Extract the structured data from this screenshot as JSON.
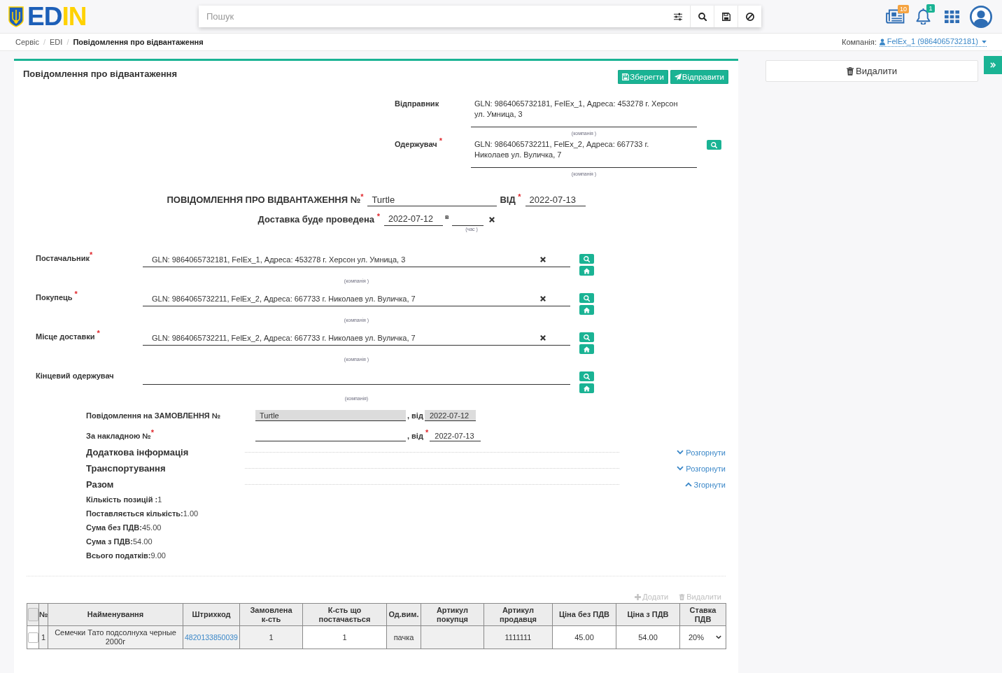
{
  "header": {
    "logo": [
      {
        "text": "ED",
        "color": "#1d5fb8"
      },
      {
        "text": "IN",
        "color": "#ffd200"
      }
    ],
    "search": {
      "placeholder": "Пошук"
    },
    "notifications": [
      {
        "kind": "news",
        "badge": "10",
        "color": "#f5a340"
      },
      {
        "kind": "bell",
        "badge": "1",
        "color": "#1ab394"
      }
    ]
  },
  "breadcrumb": [
    {
      "label": "Сервіс",
      "separator": "/",
      "current": false
    },
    {
      "label": "EDI",
      "separator": "/",
      "current": false
    },
    {
      "label": "Повідомлення про відвантаження",
      "current": true
    }
  ],
  "company": {
    "label": "Компанія:",
    "value": "FelEx_1 (9864065732181)"
  },
  "document": {
    "title": "Повідомлення про відвантаження",
    "actions": [
      {
        "kind": "save",
        "label": "Зберегти"
      },
      {
        "kind": "send",
        "label": "Відправити"
      }
    ],
    "correspondents": [
      {
        "label": "Відправник",
        "value": "GLN: 9864065732181, FelEx_1, Адреса: 453278 г. Херсон ул. Умница, 3",
        "caption": "(компанія )",
        "searchable": false
      },
      {
        "label": "Одержувач $^{*}$",
        "value": "GLN: 9864065732211, FelEx_2, Адреса: 667733 г. Николаев ул. Вуличка, 7",
        "caption": "(компанія )",
        "searchable": true
      }
    ],
    "number": {
      "label": "ПОВІДОМЛЕННЯ ПРО ВІДВАНТАЖЕННЯ №$^{*}$",
      "value": "Turtle",
      "date_label": "ВІД $^{*}$",
      "date": "2022-07-13"
    },
    "delivery": {
      "label": "Доставка буде проведена $^{*}$",
      "date": "2022-07-12",
      "time_label": "в",
      "time_caption": "(час )"
    },
    "parties": [
      {
        "label": "Постачальник$^{*}$",
        "value": "GLN: 9864065732181, FelEx_1, Адреса: 453278 г. Херсон ул. Умница, 3",
        "caption": "(компанія )"
      },
      {
        "label": "Покупець $^{*}$",
        "value": "GLN: 9864065732211, FelEx_2, Адреса: 667733 г. Николаев ул. Вуличка, 7",
        "caption": "(компанія )"
      },
      {
        "label": "Місце доставки $^{*}$",
        "value": "GLN: 9864065732211, FelEx_2, Адреса: 667733 г. Николаев ул. Вуличка, 7",
        "caption": "(компанія )"
      },
      {
        "label": "Кінцевий одержувач",
        "caption": "(компанія)"
      }
    ],
    "references": [
      {
        "label": "Повідомлення на ЗАМОВЛЕННЯ №",
        "value": "Turtle",
        "date_label": ", від",
        "date": "2022-07-12",
        "disabled": true
      },
      {
        "label": "За накладною №$^{*}$",
        "date_label": ", від $^{*}$",
        "date": "2022-07-13",
        "disabled": false
      }
    ],
    "sections": [
      {
        "title": "Додаткова інформація",
        "toggle": "Розгорнути",
        "expanded": false
      },
      {
        "title": "Транспортування",
        "toggle": "Розгорнути",
        "expanded": false
      },
      {
        "title": "Разом",
        "toggle": "Згорнути",
        "expanded": true,
        "items": [
          {
            "label": "Кількість позицій :",
            "value": "1"
          },
          {
            "label": "Поставляється кількість:",
            "value": "1.00"
          },
          {
            "label": "Сума без ПДВ:",
            "value": "45.00"
          },
          {
            "label": "Сума з ПДВ:",
            "value": "54.00"
          },
          {
            "label": "Всього податків:",
            "value": "9.00"
          }
        ]
      }
    ],
    "table": {
      "actions": [
        {
          "kind": "add",
          "label": "Додати",
          "disabled": true
        },
        {
          "kind": "delete",
          "label": "Видалити",
          "disabled": true
        }
      ],
      "select_all": {
        "checked": false
      },
      "columns": [
        {
          "label": "№",
          "editable": false
        },
        {
          "label": "Найменування",
          "editable": false
        },
        {
          "label": "Штрихкод",
          "editable": false
        },
        {
          "label": "Замовлена к-сть",
          "editable": false
        },
        {
          "label": "К-сть що постачається",
          "editable": true
        },
        {
          "label": "Од.вим.",
          "editable": false
        },
        {
          "label": "Артикул покупця",
          "editable": false
        },
        {
          "label": "Артикул продавця",
          "editable": false
        },
        {
          "label": "Ціна без ПДВ",
          "editable": true
        },
        {
          "label": "Ціна з ПДВ",
          "editable": true
        },
        {
          "label": "Ставка ПДВ",
          "editable": true
        }
      ],
      "rows": [
        {
          "checked": false,
          "cells": [
            {
              "kind": "text",
              "text": "1"
            },
            {
              "kind": "text",
              "text": "Семечки Тато подсолнуха черные 2000г"
            },
            {
              "kind": "link",
              "text": "4820133850039"
            },
            {
              "kind": "text",
              "text": "1"
            },
            {
              "kind": "text",
              "text": "1"
            },
            {
              "kind": "text",
              "text": "пачка"
            },
            {
              "kind": "blank"
            },
            {
              "kind": "text",
              "text": "1111111"
            },
            {
              "kind": "text",
              "text": "45.00"
            },
            {
              "kind": "text",
              "text": "54.00"
            },
            {
              "kind": "select",
              "text": "20%"
            }
          ]
        }
      ]
    }
  },
  "side_panel": {
    "delete_button": "Видалити"
  }
}
